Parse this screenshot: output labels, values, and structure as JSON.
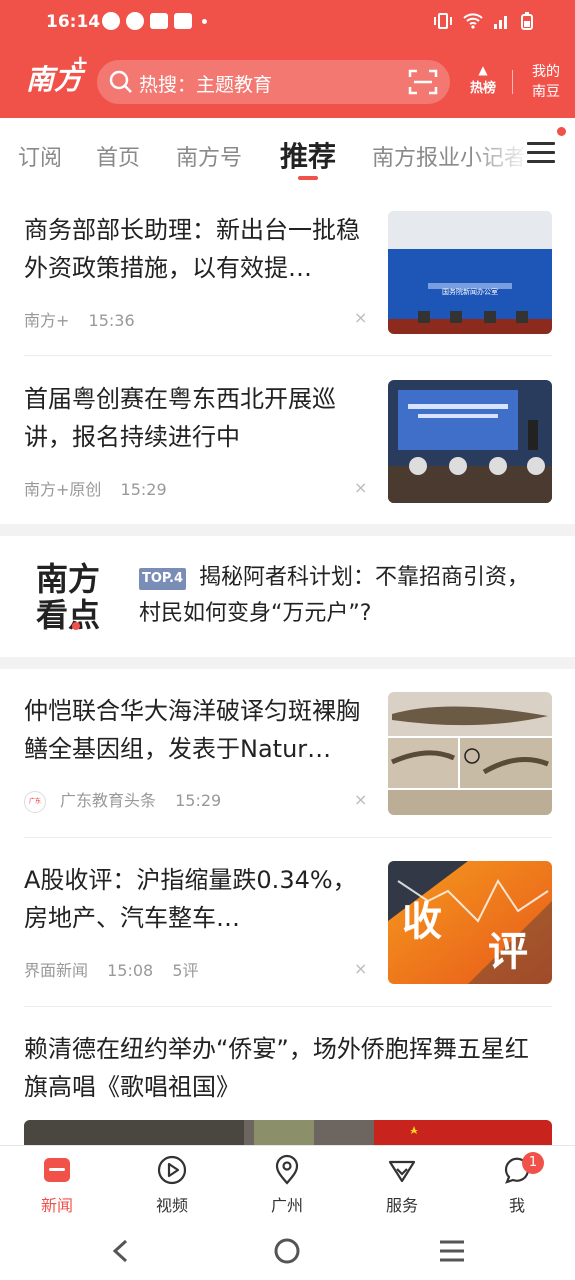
{
  "status_bar": {
    "time": "16:14"
  },
  "header": {
    "logo_text": "南方",
    "logo_plus": "+",
    "search_text": "热搜：主题教育",
    "hot_label": "热榜",
    "mine_line1": "我的",
    "mine_line2": "南豆"
  },
  "tabs": [
    "订阅",
    "首页",
    "南方号",
    "推荐",
    "南方报业小记者"
  ],
  "articles": [
    {
      "title": "商务部部长助理：新出台一批稳外资政策措施，以有效提…",
      "source": "南方+",
      "time": "15:36",
      "comments": "",
      "image_caption": "国务院新闻办公室"
    },
    {
      "title": "首届粤创赛在粤东西北开展巡讲，报名持续进行中",
      "source": "南方+原创",
      "time": "15:29",
      "comments": ""
    },
    {
      "title": "仲恺联合华大海洋破译匀斑裸胸鳝全基因组，发表于Natur…",
      "source": "广东教育头条",
      "time": "15:29",
      "comments": ""
    },
    {
      "title": "A股收评：沪指缩量跌0.34%，房地产、汽车整车…",
      "source": "界面新闻",
      "time": "15:08",
      "comments": "5评",
      "image_text1": "收",
      "image_text2": "评"
    },
    {
      "title": "赖清德在纽约举办“侨宴”，场外侨胞挥舞五星红旗高唱《歌唱祖国》"
    }
  ],
  "kandian": {
    "logo_line1": "南方",
    "logo_line2": "看点",
    "badge": "TOP.4",
    "text": "揭秘阿者科计划：不靠招商引资，村民如何变身“万元户”?"
  },
  "close_glyph": "×",
  "bottom_nav": [
    {
      "label": "新闻",
      "icon": "news-icon"
    },
    {
      "label": "视频",
      "icon": "video-icon"
    },
    {
      "label": "广州",
      "icon": "location-icon"
    },
    {
      "label": "服务",
      "icon": "service-icon"
    },
    {
      "label": "我",
      "icon": "profile-icon",
      "badge": "1"
    }
  ],
  "colors": {
    "brand": "#f0524a",
    "badge_blue": "#7a8db6"
  }
}
